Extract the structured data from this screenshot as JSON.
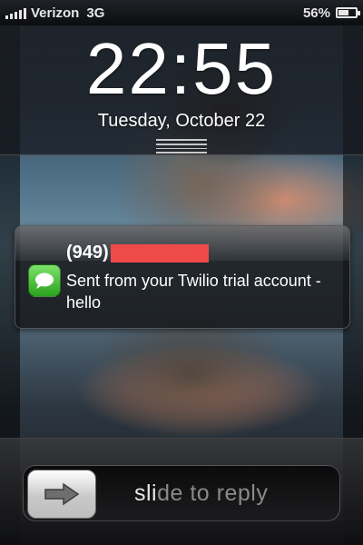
{
  "status_bar": {
    "carrier": "Verizon",
    "network": "3G",
    "battery_text": "56%",
    "battery_level": 0.56
  },
  "lockscreen": {
    "time": "22:55",
    "date": "Tuesday, October 22"
  },
  "notification": {
    "sender_prefix": "(949)",
    "message": "Sent from your Twilio trial account - hello",
    "app_icon": "messages-icon"
  },
  "slider": {
    "label_highlight": "sli",
    "label_rest": "de to reply",
    "icon": "arrow-right-icon"
  },
  "colors": {
    "redaction": "#ef4a4a",
    "messages_green": "#3dbb2c"
  }
}
